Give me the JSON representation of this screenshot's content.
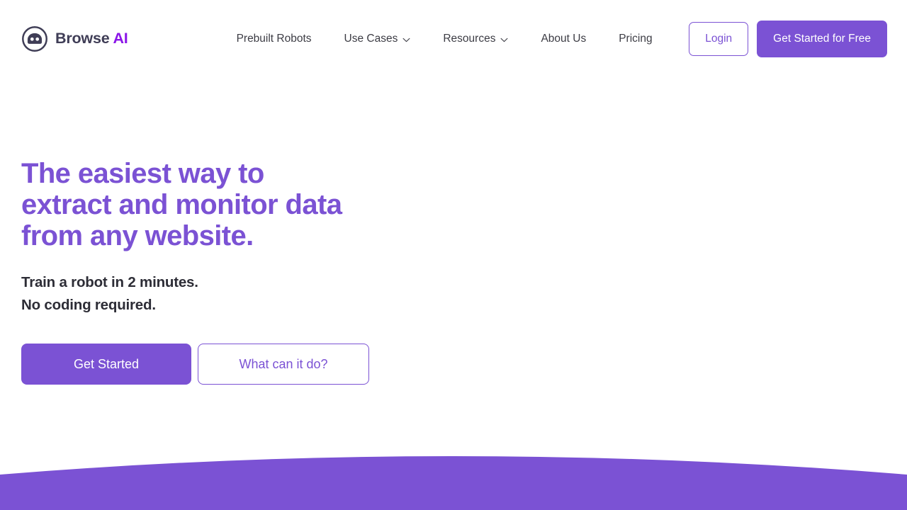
{
  "colors": {
    "brand_purple": "#7b52d4",
    "logo_ai_purple": "#8b16e8",
    "logo_text_dark": "#3f3d56",
    "nav_text": "#3c3c44",
    "heading_purple": "#7b52d4",
    "subheading_dark": "#2d2d36",
    "page_background": "#ffffff",
    "curve_purple": "#7b52d4"
  },
  "header": {
    "brand": {
      "icon": "robot-face-circle-icon",
      "word_primary": "Browse",
      "word_accent": "AI"
    },
    "nav": [
      {
        "label": "Prebuilt Robots",
        "has_dropdown": false
      },
      {
        "label": "Use Cases",
        "has_dropdown": true,
        "icon": "chevron-down-icon"
      },
      {
        "label": "Resources",
        "has_dropdown": true,
        "icon": "chevron-down-icon"
      },
      {
        "label": "About Us",
        "has_dropdown": false
      },
      {
        "label": "Pricing",
        "has_dropdown": false
      }
    ],
    "actions": {
      "login_label": "Login",
      "get_started_free_label": "Get Started for Free"
    }
  },
  "hero": {
    "title": "The easiest way to\nextract and monitor data\nfrom any website.",
    "subtitle": "Train a robot in 2 minutes.\nNo coding required.",
    "primary_cta": "Get Started",
    "secondary_cta": "What can it do?"
  },
  "decoration": {
    "bottom_curve": "purple-arc-section"
  }
}
